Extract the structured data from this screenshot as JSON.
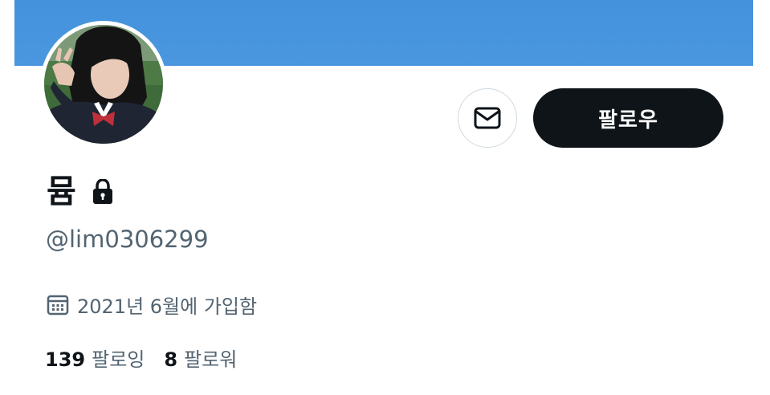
{
  "profile": {
    "display_name": "뮴",
    "handle": "@lim0306299",
    "joined": "2021년 6월에 가입함",
    "following_count": "139",
    "following_label": "팔로잉",
    "followers_count": "8",
    "followers_label": "팔로워"
  },
  "actions": {
    "follow_label": "팔로우"
  },
  "colors": {
    "banner": "#4a97df",
    "follow_button_bg": "#0f1419",
    "secondary_text": "#536471"
  },
  "icons": {
    "message": "envelope-icon",
    "protected": "lock-icon",
    "joined": "calendar-icon"
  }
}
